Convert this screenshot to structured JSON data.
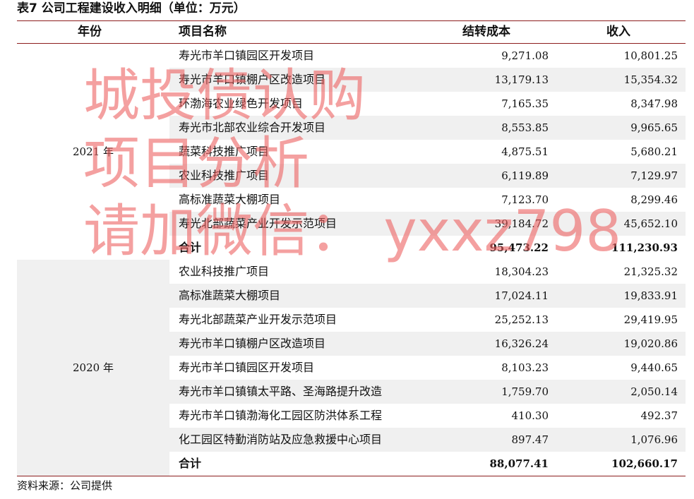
{
  "table": {
    "title": "表7 公司工程建设收入明细（单位：万元）",
    "headers": {
      "year": "年份",
      "project": "项目名称",
      "cost": "结转成本",
      "revenue": "收入"
    },
    "groups": [
      {
        "year": "2021 年",
        "rows": [
          {
            "name": "寿光市羊口镇园区开发项目",
            "cost": "9,271.08",
            "revenue": "10,801.25"
          },
          {
            "name": "寿光市羊口镇棚户区改造项目",
            "cost": "13,179.13",
            "revenue": "15,354.32"
          },
          {
            "name": "环渤海农业绿色开发项目",
            "cost": "7,165.35",
            "revenue": "8,347.98"
          },
          {
            "name": "寿光市北部农业综合开发项目",
            "cost": "8,553.85",
            "revenue": "9,965.65"
          },
          {
            "name": "蔬菜科技推广项目",
            "cost": "4,875.51",
            "revenue": "5,680.21"
          },
          {
            "name": "农业科技推广项目",
            "cost": "6,119.89",
            "revenue": "7,129.97"
          },
          {
            "name": "高标准蔬菜大棚项目",
            "cost": "7,123.70",
            "revenue": "8,299.46"
          },
          {
            "name": "寿光北部蔬菜产业开发示范项目",
            "cost": "39,184.72",
            "revenue": "45,652.10"
          }
        ],
        "total": {
          "name": "合计",
          "cost": "95,473.22",
          "revenue": "111,230.93"
        }
      },
      {
        "year": "2020 年",
        "rows": [
          {
            "name": "农业科技推广项目",
            "cost": "18,304.23",
            "revenue": "21,325.32"
          },
          {
            "name": "高标准蔬菜大棚项目",
            "cost": "17,024.11",
            "revenue": "19,833.91"
          },
          {
            "name": "寿光北部蔬菜产业开发示范项目",
            "cost": "25,252.13",
            "revenue": "29,419.95"
          },
          {
            "name": "寿光市羊口镇棚户区改造项目",
            "cost": "16,326.24",
            "revenue": "19,020.86"
          },
          {
            "name": "寿光市羊口镇园区开发项目",
            "cost": "8,103.23",
            "revenue": "9,440.65"
          },
          {
            "name": "寿光市羊口镇镇太平路、圣海路提升改造",
            "cost": "1,759.70",
            "revenue": "2,050.14"
          },
          {
            "name": "寿光市羊口镇渤海化工园区防洪体系工程",
            "cost": "410.30",
            "revenue": "492.37"
          },
          {
            "name": "化工园区特勤消防站及应急救援中心项目",
            "cost": "897.47",
            "revenue": "1,076.96"
          }
        ],
        "total": {
          "name": "合计",
          "cost": "88,077.41",
          "revenue": "102,660.17"
        }
      }
    ],
    "source": "资料来源：公司提供"
  },
  "watermark": {
    "lines": [
      "城投债认购",
      "项目分析",
      "请加微信： yxxz798"
    ]
  }
}
